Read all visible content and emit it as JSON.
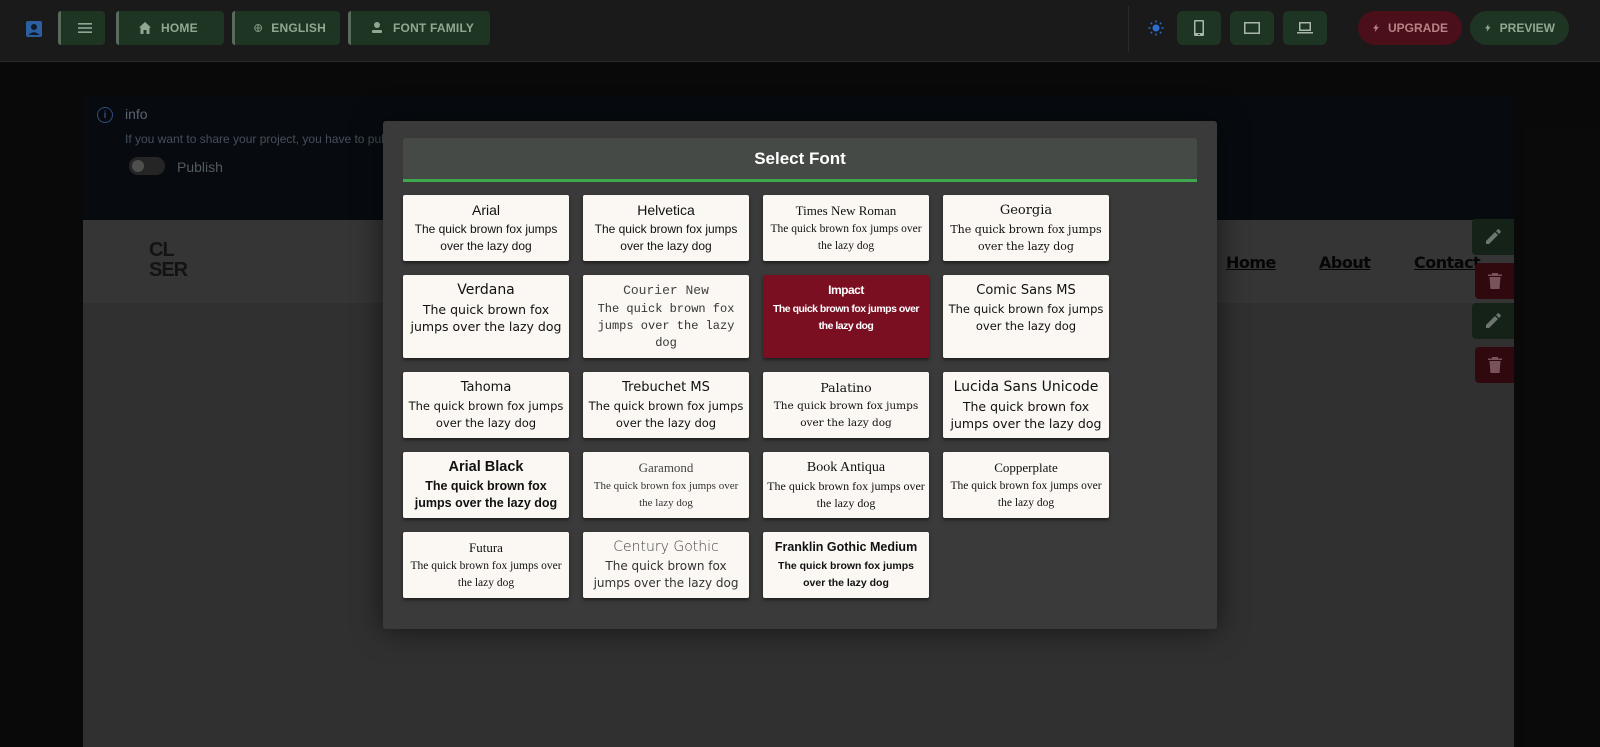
{
  "topbar": {
    "home_label": "HOME",
    "language_label": "ENGLISH",
    "font_family_label": "FONT FAMILY",
    "upgrade_label": "UPGRADE",
    "preview_label": "PREVIEW"
  },
  "info": {
    "title": "info",
    "text": "If you want to share your project, you have to publ",
    "publish_label": "Publish"
  },
  "site": {
    "logo_line1": "CL",
    "logo_line2": "SER",
    "nav": [
      "Home",
      "About",
      "Contact"
    ]
  },
  "modal": {
    "title": "Select Font",
    "sample_text": "The quick brown fox jumps over the lazy dog",
    "fonts": [
      {
        "name": "Arial",
        "sample": "The quick brown fox jumps over the lazy dog"
      },
      {
        "name": "Helvetica",
        "sample": "The quick brown fox jumps over the lazy dog"
      },
      {
        "name": "Times New Roman",
        "sample": "The quick brown fox jumps over the lazy dog"
      },
      {
        "name": "Georgia",
        "sample": "The quick brown fox jumps over the lazy dog"
      },
      {
        "name": "Verdana",
        "sample": "The quick brown fox jumps over the lazy dog"
      },
      {
        "name": "Courier New",
        "sample": "The quick brown fox jumps over the lazy dog"
      },
      {
        "name": "Impact",
        "sample": "The quick brown fox jumps over the lazy dog",
        "selected": true
      },
      {
        "name": "Comic Sans MS",
        "sample": "The quick brown fox jumps over the lazy dog"
      },
      {
        "name": "Tahoma",
        "sample": "The quick brown fox jumps over the lazy dog"
      },
      {
        "name": "Trebuchet MS",
        "sample": "The quick brown fox jumps over the lazy dog"
      },
      {
        "name": "Palatino",
        "sample": "The quick brown fox jumps over the lazy dog"
      },
      {
        "name": "Lucida Sans Unicode",
        "sample": "The quick brown fox jumps over the lazy dog"
      },
      {
        "name": "Arial Black",
        "sample": "The quick brown fox jumps over the lazy dog"
      },
      {
        "name": "Garamond",
        "sample": "The quick brown fox jumps over the lazy dog"
      },
      {
        "name": "Book Antiqua",
        "sample": "The quick brown fox jumps over the lazy dog"
      },
      {
        "name": "Copperplate",
        "sample": "The quick brown fox jumps over the lazy dog"
      },
      {
        "name": "Futura",
        "sample": "The quick brown fox jumps over the lazy dog"
      },
      {
        "name": "Century Gothic",
        "sample": "The quick brown fox jumps over the lazy dog"
      },
      {
        "name": "Franklin Gothic Medium",
        "sample": "The quick brown fox jumps over the lazy dog"
      }
    ]
  },
  "colors": {
    "accent_green": "#3faa4d",
    "selected_red": "#7a0f22",
    "button_green": "#1f3524",
    "button_red": "#4a0f18"
  }
}
